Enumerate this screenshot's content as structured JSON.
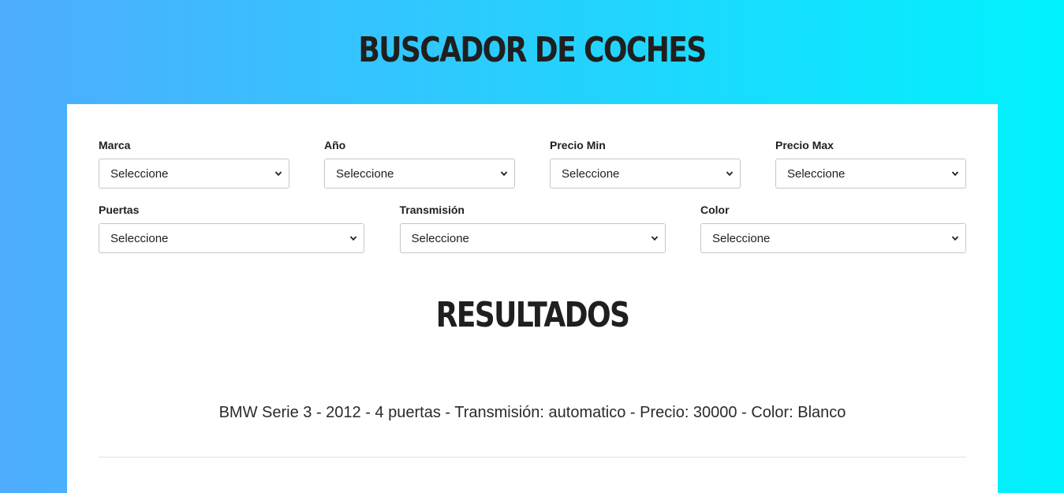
{
  "header": {
    "title": "Buscador de coches"
  },
  "filters": {
    "marca": {
      "label": "Marca",
      "value": "Seleccione"
    },
    "anio": {
      "label": "Año",
      "value": "Seleccione"
    },
    "precio_min": {
      "label": "Precio Min",
      "value": "Seleccione"
    },
    "precio_max": {
      "label": "Precio Max",
      "value": "Seleccione"
    },
    "puertas": {
      "label": "Puertas",
      "value": "Seleccione"
    },
    "transmision": {
      "label": "Transmisión",
      "value": "Seleccione"
    },
    "color": {
      "label": "Color",
      "value": "Seleccione"
    }
  },
  "results": {
    "title": "Resultados",
    "items": [
      "BMW Serie 3 - 2012 - 4 puertas - Transmisión: automatico - Precio: 30000 - Color: Blanco"
    ]
  },
  "theme": {
    "gradient_start": "#4facfe",
    "gradient_end": "#00f2fe",
    "card_background": "#ffffff",
    "text_color": "#1f1f1f"
  },
  "icons": {
    "select_arrow": "chevron-down-icon"
  }
}
